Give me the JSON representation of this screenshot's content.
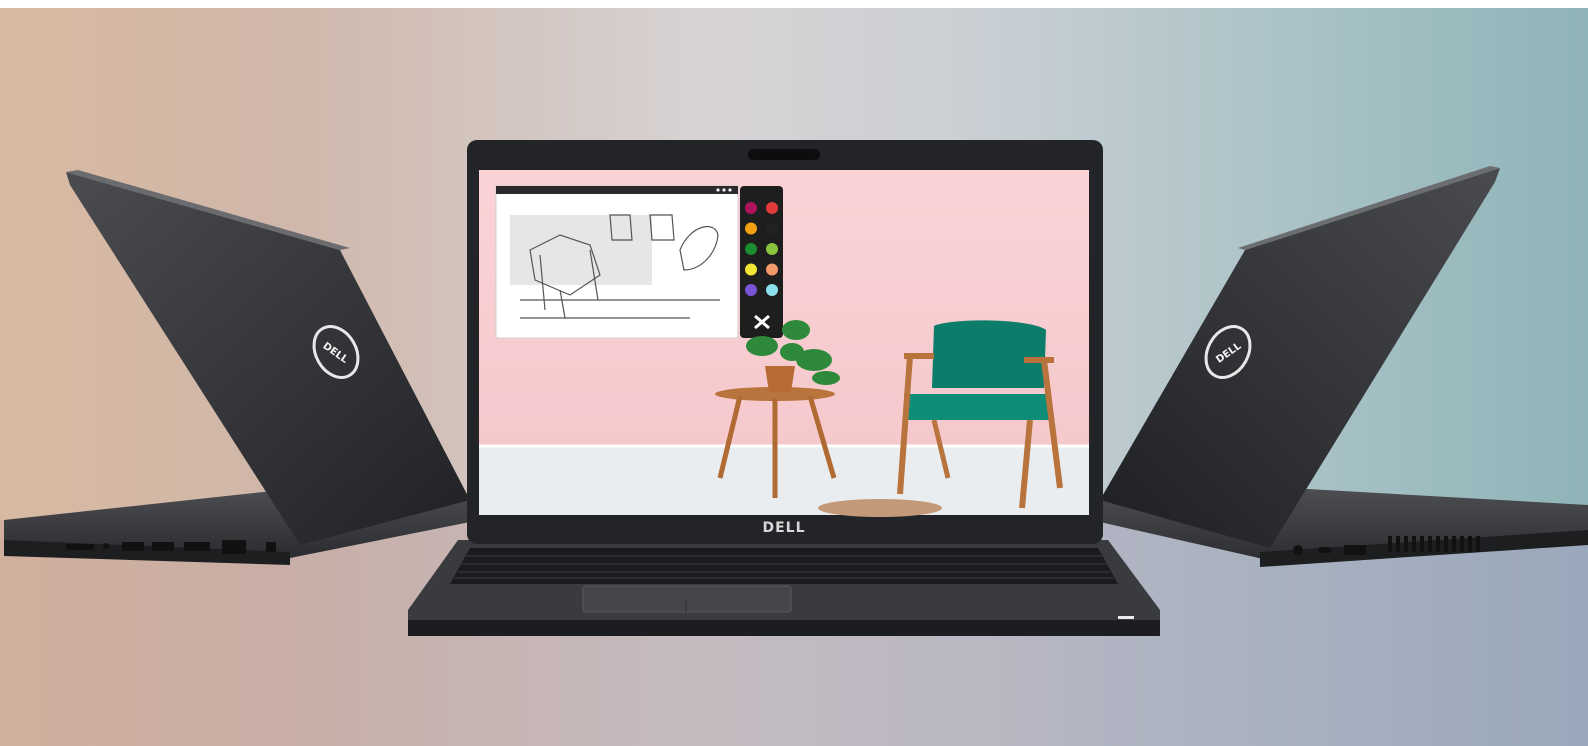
{
  "brand": {
    "front_bezel_logo": "DELL",
    "lid_logo": "DELL"
  },
  "colors": {
    "laptop_body": "#2f3033",
    "screen_wall": "#f7cfd3",
    "chair_fabric": "#0c7d6b",
    "wood": "#b9743d"
  },
  "palette_swatches": [
    "#b0125b",
    "#e23b3b",
    "#f0a010",
    "#222222",
    "#1b8e2f",
    "#8bc33f",
    "#f3e533",
    "#f39a6a",
    "#7b55d8",
    "#8ee0ef"
  ],
  "icons": [
    "close-icon",
    "window-dots-icon"
  ]
}
